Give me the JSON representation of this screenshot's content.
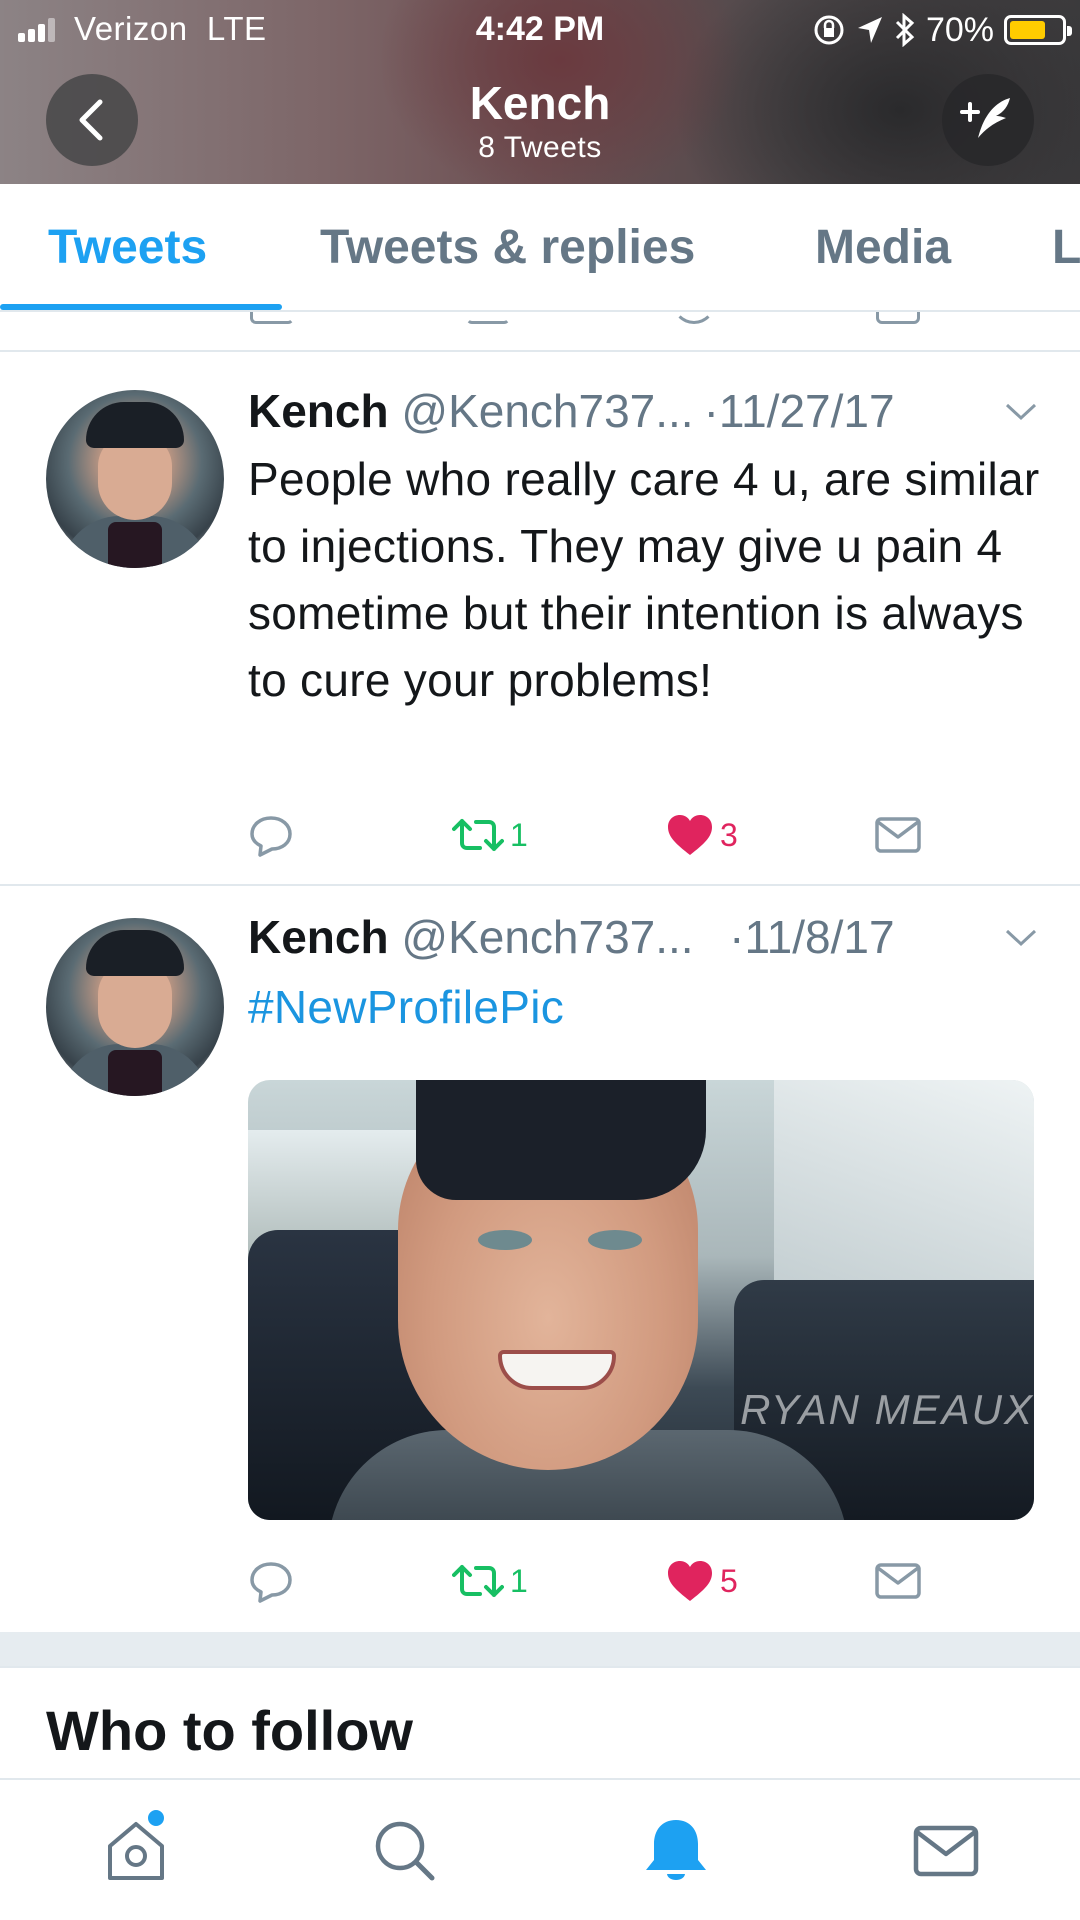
{
  "status_bar": {
    "carrier": "Verizon",
    "network": "LTE",
    "time": "4:42 PM",
    "battery_percent": "70%",
    "battery_level": 0.7,
    "icons": [
      "lock-rotation-icon",
      "location-arrow-icon",
      "bluetooth-icon"
    ]
  },
  "header": {
    "title": "Kench",
    "subtitle": "8 Tweets",
    "back_icon": "chevron-left-icon",
    "compose_icon": "compose-tweet-icon"
  },
  "tabs": [
    {
      "label": "Tweets",
      "active": true
    },
    {
      "label": "Tweets & replies",
      "active": false
    },
    {
      "label": "Media",
      "active": false
    },
    {
      "label": "L",
      "active": false
    }
  ],
  "tweets": [
    {
      "name": "Kench",
      "handle": "@Kench737...",
      "date": "11/27/17",
      "text": "People who really care 4 u, are similar to injections. They may give u pain 4 sometime but their intention is always to cure your problems!",
      "retweets": "1",
      "likes": "3"
    },
    {
      "name": "Kench",
      "handle": "@Kench737...",
      "date": "11/8/17",
      "text": "#NewProfilePic",
      "image_watermark": "RYAN MEAUX",
      "retweets": "1",
      "likes": "5"
    }
  ],
  "who_to_follow": {
    "title": "Who to follow"
  },
  "bottom_nav": {
    "items": [
      "home-icon",
      "search-icon",
      "notifications-bell-icon",
      "messages-icon"
    ],
    "active": "notifications-bell-icon"
  },
  "colors": {
    "accent": "#1da1f2",
    "retweet": "#17bf63",
    "like": "#e0245e",
    "muted": "#657786"
  }
}
